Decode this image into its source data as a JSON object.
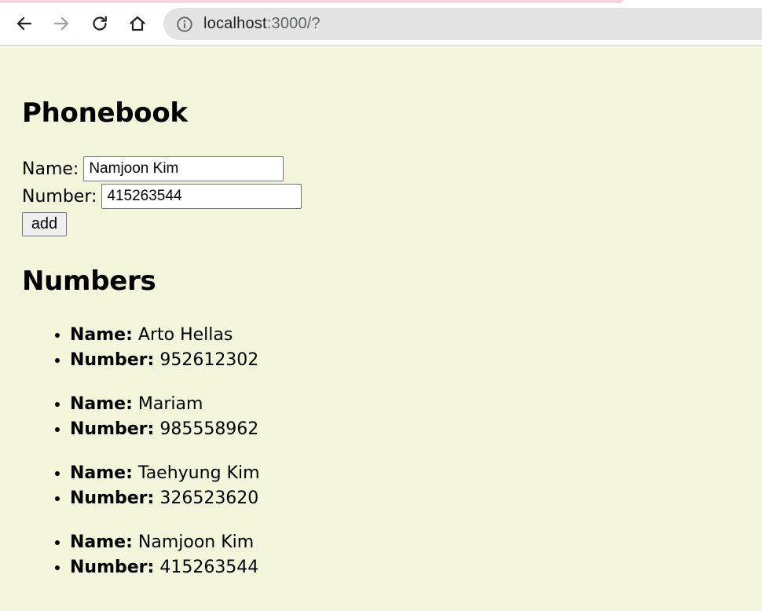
{
  "browser": {
    "url_host": "localhost",
    "url_rest": ":3000/?"
  },
  "page": {
    "title": "Phonebook",
    "form": {
      "name_label": "Name:",
      "name_value": "Namjoon Kim",
      "number_label": "Number:",
      "number_value": "415263544",
      "add_label": "add"
    },
    "numbers_title": "Numbers",
    "entries": [
      {
        "name_label": "Name:",
        "name": "Arto Hellas",
        "number_label": "Number:",
        "number": "952612302"
      },
      {
        "name_label": "Name:",
        "name": "Mariam",
        "number_label": "Number:",
        "number": "985558962"
      },
      {
        "name_label": "Name:",
        "name": "Taehyung Kim",
        "number_label": "Number:",
        "number": "326523620"
      },
      {
        "name_label": "Name:",
        "name": "Namjoon Kim",
        "number_label": "Number:",
        "number": "415263544"
      }
    ]
  },
  "icons": {
    "back": "arrow-left-icon",
    "forward": "arrow-right-icon",
    "reload": "reload-icon",
    "home": "home-icon",
    "info": "info-icon"
  },
  "colors": {
    "page_background": "#f5f5dc",
    "address_bar": "#e3e3e3",
    "tab_strip": "#f6d3dd"
  }
}
